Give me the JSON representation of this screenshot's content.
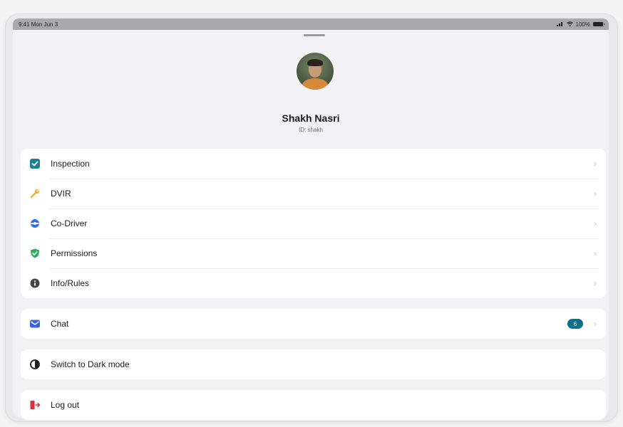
{
  "status_bar": {
    "time": "9:41 Mon Jun 3",
    "battery_text": "100%"
  },
  "profile": {
    "name": "Shakh Nasri",
    "id_text": "ID: shakh"
  },
  "menu": [
    {
      "label": "Inspection",
      "icon": "checkbox-icon",
      "color": "#1d7f95"
    },
    {
      "label": "DVIR",
      "icon": "wrench-icon",
      "color": "#f2b233"
    },
    {
      "label": "Co-Driver",
      "icon": "steering-wheel-icon",
      "color": "#2e6ee8"
    },
    {
      "label": "Permissions",
      "icon": "shield-check-icon",
      "color": "#2fae60"
    },
    {
      "label": "Info/Rules",
      "icon": "info-icon",
      "color": "#444446"
    }
  ],
  "chat": {
    "label": "Chat",
    "badge": "6",
    "icon": "mail-icon",
    "color": "#3b63e0"
  },
  "theme": {
    "label": "Switch to Dark mode",
    "icon": "half-moon-icon"
  },
  "logout": {
    "label": "Log out",
    "icon": "logout-icon",
    "color": "#e02d3c"
  }
}
